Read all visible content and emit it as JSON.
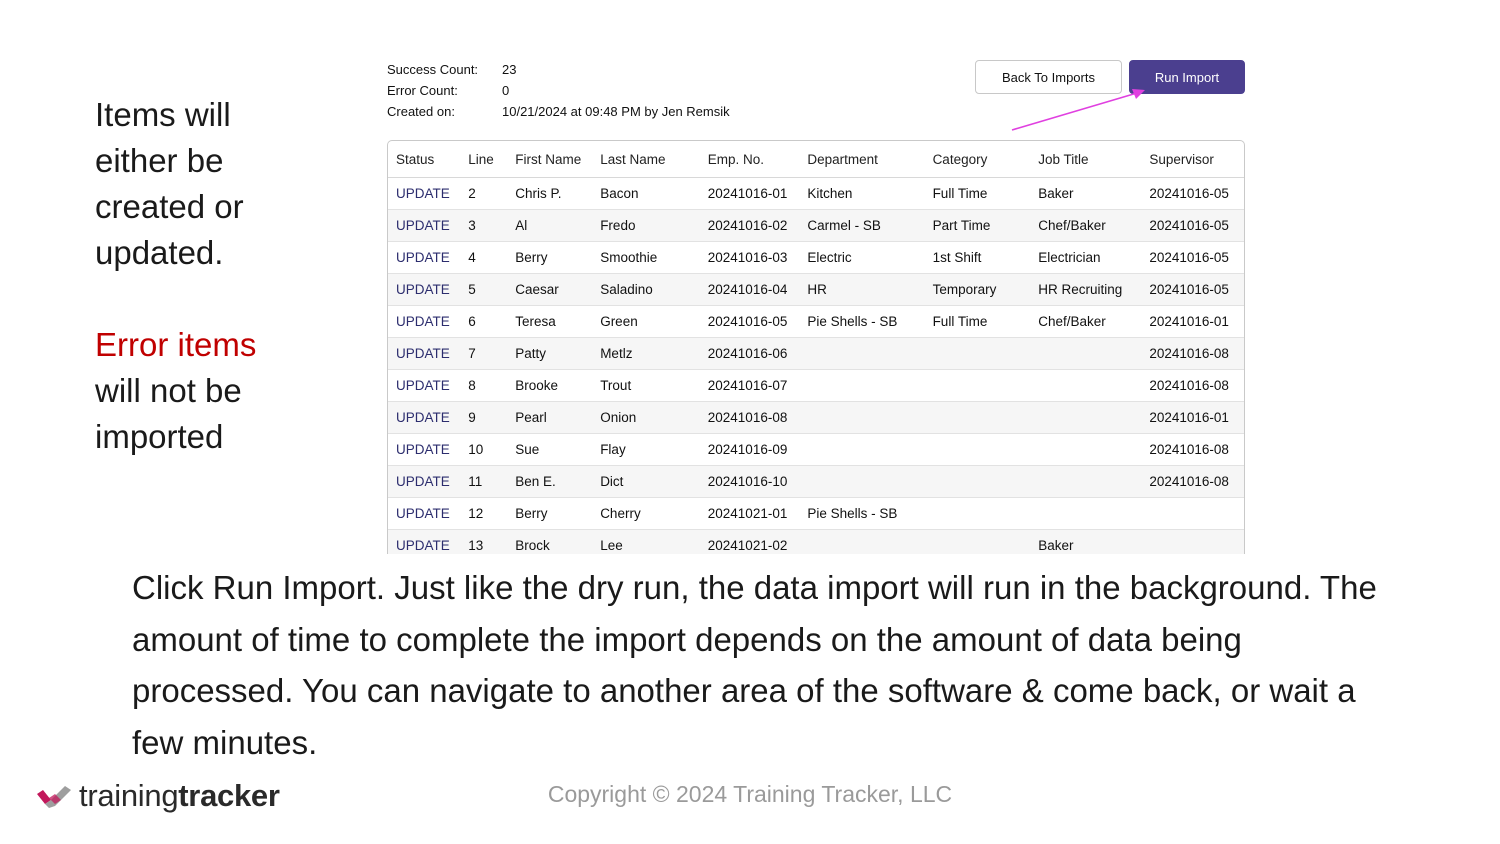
{
  "left_note": {
    "line1": "Items will",
    "line2": "either be",
    "line3": "created or",
    "line4": "updated.",
    "error_line1": "Error items",
    "error_line2": "will not be",
    "error_line3": "imported"
  },
  "meta": {
    "success_label": "Success Count:",
    "success_value": "23",
    "error_label": "Error Count:",
    "error_value": "0",
    "created_label": "Created on:",
    "created_value": "10/21/2024 at 09:48 PM by Jen Remsik"
  },
  "buttons": {
    "back": "Back To Imports",
    "run": "Run Import"
  },
  "colors": {
    "accent": "#4b3f8f",
    "status": "#2c2d6e",
    "error": "#c00000",
    "arrow": "#e040e0"
  },
  "table": {
    "headers": [
      "Status",
      "Line",
      "First Name",
      "Last Name",
      "Emp. No.",
      "Department",
      "Category",
      "Job Title",
      "Supervisor"
    ],
    "rows": [
      [
        "UPDATE",
        "2",
        "Chris P.",
        "Bacon",
        "20241016-01",
        "Kitchen",
        "Full Time",
        "Baker",
        "20241016-05"
      ],
      [
        "UPDATE",
        "3",
        "Al",
        "Fredo",
        "20241016-02",
        "Carmel - SB",
        "Part Time",
        "Chef/Baker",
        "20241016-05"
      ],
      [
        "UPDATE",
        "4",
        "Berry",
        "Smoothie",
        "20241016-03",
        "Electric",
        "1st Shift",
        "Electrician",
        "20241016-05"
      ],
      [
        "UPDATE",
        "5",
        "Caesar",
        "Saladino",
        "20241016-04",
        "HR",
        "Temporary",
        "HR Recruiting",
        "20241016-05"
      ],
      [
        "UPDATE",
        "6",
        "Teresa",
        "Green",
        "20241016-05",
        "Pie Shells - SB",
        "Full Time",
        "Chef/Baker",
        "20241016-01"
      ],
      [
        "UPDATE",
        "7",
        "Patty",
        "Metlz",
        "20241016-06",
        "",
        "",
        "",
        "20241016-08"
      ],
      [
        "UPDATE",
        "8",
        "Brooke",
        "Trout",
        "20241016-07",
        "",
        "",
        "",
        "20241016-08"
      ],
      [
        "UPDATE",
        "9",
        "Pearl",
        "Onion",
        "20241016-08",
        "",
        "",
        "",
        "20241016-01"
      ],
      [
        "UPDATE",
        "10",
        "Sue",
        "Flay",
        "20241016-09",
        "",
        "",
        "",
        "20241016-08"
      ],
      [
        "UPDATE",
        "11",
        "Ben E.",
        "Dict",
        "20241016-10",
        "",
        "",
        "",
        "20241016-08"
      ],
      [
        "UPDATE",
        "12",
        "Berry",
        "Cherry",
        "20241021-01",
        "Pie Shells - SB",
        "",
        "",
        ""
      ],
      [
        "UPDATE",
        "13",
        "Brock",
        "Lee",
        "20241021-02",
        "",
        "",
        "Baker",
        ""
      ]
    ]
  },
  "caption": "Click Run Import. Just like the dry run, the data import will run in the background. The amount of time to complete the import depends on the amount of data being processed. You can navigate to another area of the software & come back, or wait a few minutes.",
  "logo": {
    "part1": "training",
    "part2": "tracker",
    "icon": "checkmark-logo-icon"
  },
  "copyright": "Copyright © 2024 Training Tracker, LLC"
}
